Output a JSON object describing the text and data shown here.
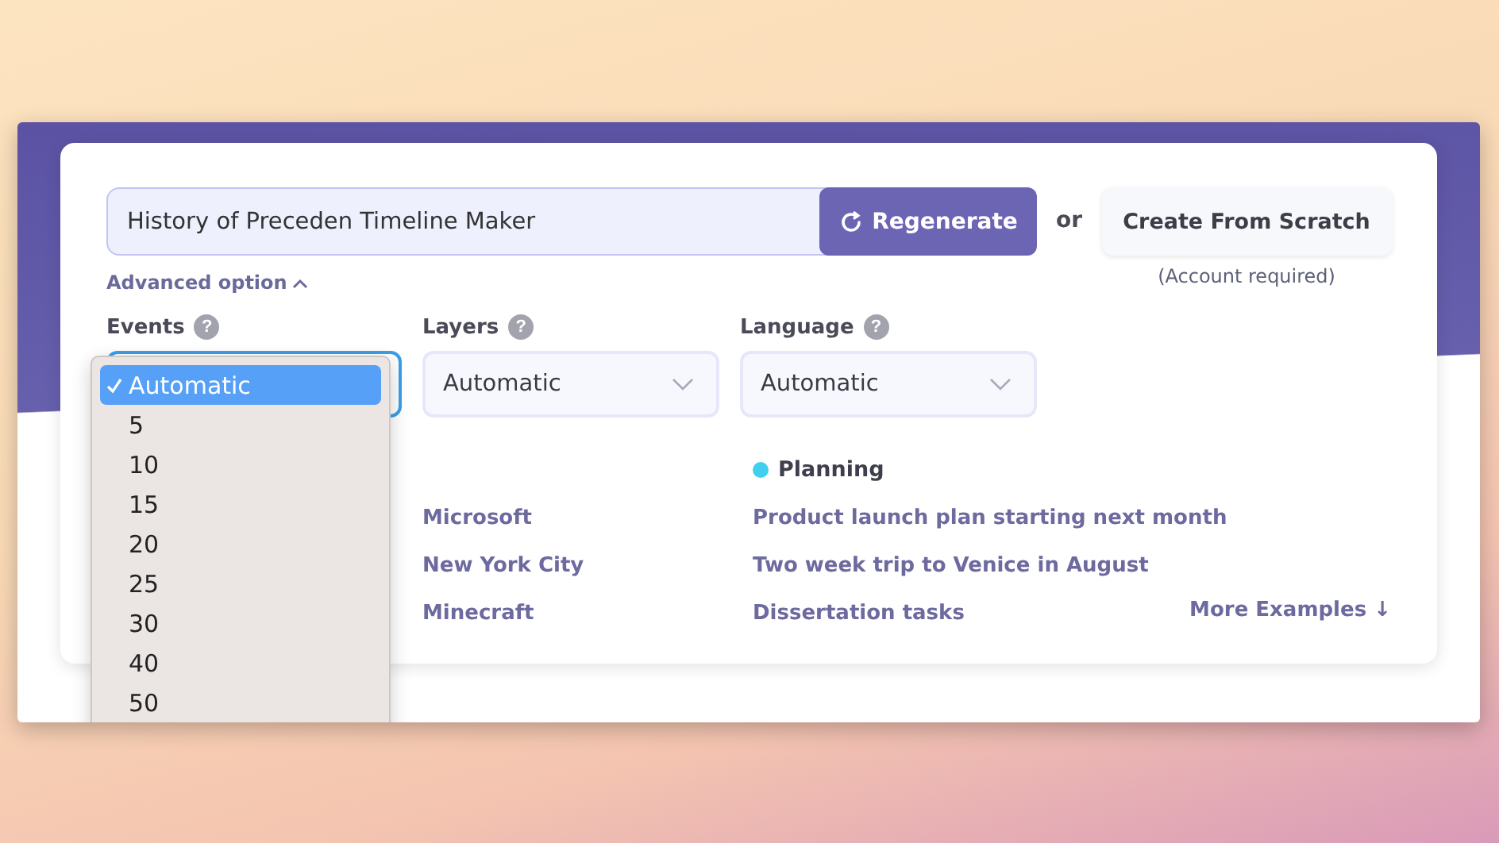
{
  "topic_field": {
    "value": "History of Preceden Timeline Maker"
  },
  "regenerate_button": "Regenerate",
  "or_label": "or",
  "scratch_button": "Create From Scratch",
  "scratch_note": "(Account required)",
  "advanced_toggle": {
    "label": "Advanced option",
    "expanded": true
  },
  "settings": [
    {
      "label": "Events",
      "help": "?",
      "focused": true
    },
    {
      "label": "Layers",
      "help": "?",
      "value": "Automatic",
      "focused": false
    },
    {
      "label": "Language",
      "help": "?",
      "value": "Automatic",
      "focused": false
    }
  ],
  "events_menu": [
    {
      "label": "Automatic",
      "selected": true
    },
    {
      "label": "5",
      "selected": false
    },
    {
      "label": "10",
      "selected": false
    },
    {
      "label": "15",
      "selected": false
    },
    {
      "label": "20",
      "selected": false
    },
    {
      "label": "25",
      "selected": false
    },
    {
      "label": "30",
      "selected": false
    },
    {
      "label": "40",
      "selected": false
    },
    {
      "label": "50",
      "selected": false
    }
  ],
  "example_groups": [
    {
      "items": [
        "Microsoft",
        "New York City",
        "Minecraft"
      ]
    },
    {
      "heading": "Planning",
      "color": "#3fd0ef",
      "items": [
        "Product launch plan starting next month",
        "Two week trip to Venice in August",
        "Dissertation tasks"
      ]
    }
  ],
  "more_examples": "More Examples ↓"
}
